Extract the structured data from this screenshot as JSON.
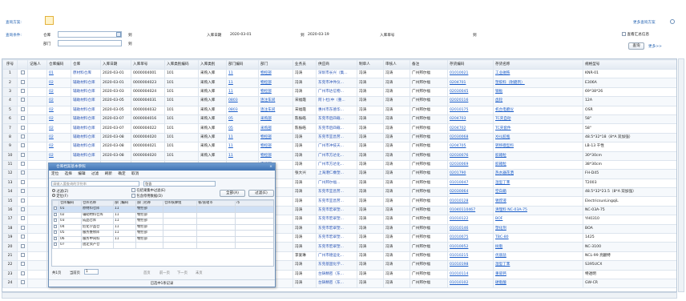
{
  "query_scheme": {
    "label": "查询方案:"
  },
  "more_schemes": "更多查询方案",
  "conditions": {
    "label": "查询条件:",
    "warehouse": "仓库",
    "to1": "到",
    "dept": "部门",
    "in_date": "入库日期",
    "date_from": "2020-03-01",
    "to2": "到",
    "date_to": "2020-03-19",
    "in_no": "入库单号",
    "to3": "到"
  },
  "summary_check": "查看汇总信息",
  "query_btn": "查询",
  "more_link": "更多>>",
  "columns": [
    "序号",
    "",
    "记账人",
    "仓库编码",
    "仓库",
    "入库日期",
    "入库单号",
    "入库类别编码",
    "入库类别",
    "部门编码",
    "部门",
    "业务员",
    "供应商",
    "制单人",
    "审核人",
    "备注",
    "存货编码",
    "存货名称",
    "规格型号"
  ],
  "rows": [
    [
      "1",
      "",
      "",
      "01",
      "原材料仓库",
      "2020-03-01",
      "0000004001",
      "101",
      "采购入库",
      "11",
      "物控部",
      "冯涛",
      "深圳市长兴（集...",
      "冯涛",
      "冯涛",
      "广州邦尔福",
      "01010021",
      "工业磁铁",
      "KNR-01"
    ],
    [
      "2",
      "",
      "",
      "02",
      "辅助材料仓库",
      "2020-03-01",
      "0000004023",
      "101",
      "采购入库",
      "11",
      "物控部",
      "冯涛",
      "东莞市冲件仪...",
      "冯涛",
      "冯涛",
      "广州邦尔福",
      "0204701",
      "塑胶料（耐磨剂）",
      "E306A"
    ],
    [
      "3",
      "",
      "",
      "02",
      "辅助材料仓库",
      "2020-03-03",
      "0000004024",
      "101",
      "采购入库",
      "11",
      "物控部",
      "冯涛",
      "广州市达信物...",
      "冯涛",
      "冯涛",
      "广州邦尔福",
      "02030045",
      "钢板",
      "69*38*26"
    ],
    [
      "4",
      "",
      "",
      "02",
      "辅助材料仓库",
      "2020-03-05",
      "0000004031",
      "101",
      "采购入库",
      "0803",
      "连注车间",
      "宋福霞",
      "阿卜杜(中（重...",
      "冯涛",
      "冯涛",
      "广州邦尔福",
      "02020116",
      "齿轮",
      "12A"
    ],
    [
      "5",
      "",
      "",
      "02",
      "辅助材料仓库",
      "2020-03-05",
      "0000004032",
      "101",
      "采购入库",
      "0803",
      "连注车间",
      "宋福霞",
      "惠州市东德华...",
      "冯涛",
      "冯涛",
      "广州邦尔福",
      "02010175",
      "机台电磨仪",
      "OSR"
    ],
    [
      "6",
      "",
      "",
      "02",
      "辅助材料仓库",
      "2020-03-07",
      "0000004016",
      "101",
      "采购入库",
      "05",
      "采购部",
      "陈振皓",
      "东莞市后四载...",
      "冯涛",
      "冯涛",
      "广州邦尔福",
      "0204703",
      "TC夹自动",
      "58\""
    ],
    [
      "7",
      "",
      "",
      "02",
      "辅助材料仓库",
      "2020-03-07",
      "0000004022",
      "101",
      "采购入库",
      "05",
      "采购部",
      "陈振皓",
      "东莞市后四载...",
      "冯涛",
      "冯涛",
      "广州邦尔福",
      "0204702",
      "TC夹套件",
      "58\""
    ],
    [
      "8",
      "",
      "",
      "02",
      "辅助材料仓库",
      "2020-03-08",
      "0000004020",
      "101",
      "采购入库",
      "11",
      "物控部",
      "冯涛",
      "东莞市宜昌劳...",
      "冯涛",
      "冯涛",
      "广州邦尔福",
      "02030068",
      "XHL胶瓶",
      "48.5*32*18（8*A 双加强）"
    ],
    [
      "9",
      "",
      "",
      "02",
      "辅助材料仓库",
      "2020-03-08",
      "0000004021",
      "101",
      "采购入库",
      "11",
      "物控部",
      "冯涛",
      "广州市冲技天...",
      "冯涛",
      "冯涛",
      "广州邦尔福",
      "0204705",
      "转移膜型料",
      "LB-13 干性"
    ],
    [
      "10",
      "",
      "",
      "02",
      "辅助材料仓库",
      "2020-03-08",
      "0000004020",
      "101",
      "采购入库",
      "11",
      "物控部",
      "冯涛",
      "广州市方达化...",
      "冯涛",
      "冯涛",
      "广州邦尔福",
      "02030076",
      "胶箱粒",
      "30*30cm"
    ],
    [
      "11",
      "",
      "",
      "",
      "",
      "",
      "",
      "",
      "",
      "",
      "物控部",
      "冯涛",
      "广州市方达化...",
      "冯涛",
      "冯涛",
      "广州邦尔福",
      "02030069",
      "胶箱粒",
      "38*30cm"
    ],
    [
      "12",
      "",
      "",
      "",
      "",
      "",
      "",
      "",
      "",
      "",
      "行政部",
      "张大兴",
      "上海港仁橡塑...",
      "冯涛",
      "冯涛",
      "广州邦尔福",
      "0201790",
      "热水器花洒",
      "FH-D45"
    ],
    [
      "13",
      "",
      "",
      "",
      "",
      "",
      "",
      "",
      "",
      "",
      "物控部",
      "冯涛",
      "广州邦尔福...",
      "冯涛",
      "冯涛",
      "广州邦尔福",
      "01010047",
      "湿型丁苯",
      "T2003"
    ],
    [
      "14",
      "",
      "",
      "",
      "",
      "",
      "",
      "",
      "",
      "",
      "物控部",
      "冯涛",
      "东莞市宜昌劳...",
      "冯涛",
      "冯涛",
      "广州邦尔福",
      "02030064",
      "空白箱",
      "48.5*32*23.5（8*A 双加强）"
    ],
    [
      "15",
      "",
      "",
      "",
      "",
      "",
      "",
      "",
      "",
      "",
      "物控部",
      "冯涛",
      "东莞市宜昌劳...",
      "冯涛",
      "冯涛",
      "广州邦尔福",
      "01010128",
      "锡焊液",
      "ElectricsunLingqiL"
    ],
    [
      "16",
      "",
      "",
      "",
      "",
      "",
      "",
      "",
      "",
      "",
      "物控部",
      "冯涛",
      "东莞市宏翠塑...",
      "冯涛",
      "冯涛",
      "广州邦尔福",
      "01040110467",
      "清理料 NC-03A-75",
      "NC-03A-75"
    ],
    [
      "17",
      "",
      "",
      "",
      "",
      "",
      "",
      "",
      "",
      "",
      "物控部",
      "冯涛",
      "东莞市宏翠塑...",
      "冯涛",
      "冯涛",
      "广州邦尔福",
      "01010122",
      "BOF",
      "YH0310"
    ],
    [
      "18",
      "",
      "",
      "",
      "",
      "",
      "",
      "",
      "",
      "",
      "物控部",
      "冯涛",
      "东莞市宏翠塑...",
      "冯涛",
      "冯涛",
      "广州邦尔福",
      "01010146",
      "塑化剂",
      "BOA"
    ],
    [
      "19",
      "",
      "",
      "",
      "",
      "",
      "",
      "",
      "",
      "",
      "物控部",
      "冯涛",
      "东莞市宏翠塑...",
      "冯涛",
      "冯涛",
      "广州邦尔福",
      "01010075",
      "TBC-80",
      "1425"
    ],
    [
      "20",
      "",
      "",
      "",
      "",
      "",
      "",
      "",
      "",
      "",
      "物控部",
      "冯涛",
      "东莞市宏翠塑...",
      "冯涛",
      "冯涛",
      "广州邦尔福",
      "01010052",
      "树脂",
      "NC-3100"
    ],
    [
      "21",
      "",
      "",
      "",
      "",
      "",
      "",
      "",
      "",
      "",
      "物控部",
      "李爱琳",
      "广州市德运化...",
      "冯涛",
      "冯涛",
      "广州邦尔福",
      "01010215",
      "优丽盐",
      "NCL-99  亮翻特"
    ],
    [
      "22",
      "",
      "",
      "",
      "",
      "",
      "",
      "",
      "",
      "",
      "物控部",
      "冯涛",
      "东莞基固化学...",
      "冯涛",
      "冯涛",
      "广州邦尔福",
      "01010198",
      "湿型丁苯",
      "S395UCX"
    ],
    [
      "23",
      "",
      "",
      "",
      "",
      "",
      "",
      "",
      "",
      "",
      "物控部",
      "冯涛",
      "台铸精密（东...",
      "冯涛",
      "冯涛",
      "广州邦尔福",
      "01010114",
      "重碳钙",
      "特透明"
    ],
    [
      "24",
      "",
      "",
      "",
      "",
      "",
      "",
      "",
      "",
      "",
      "物控部",
      "冯涛",
      "台铸精密（东...",
      "冯涛",
      "冯涛",
      "广州邦尔福",
      "01010102",
      "硬脂酸",
      "GW-CR"
    ]
  ],
  "dialog": {
    "title": "仓库档案基本参照",
    "toolbar": [
      "定位",
      "选择",
      "编辑",
      "过滤",
      "刷新",
      "确定",
      "取消"
    ],
    "search_placeholder": "请输入要查询的字符串",
    "contains_label": "包含",
    "radio_filter": "过滤(Z)",
    "radio_locate": "定位(F)",
    "chk_in_result": "在结果集中过滤(E)",
    "chk_contain": "包含停用数据(D)",
    "btn_all": "全部(A)",
    "btn_filter": "过滤(E)",
    "columns": [
      "",
      "仓库编码",
      "仓库名称",
      "部门编码",
      "部门名称",
      "仓库核算组",
      "省/直辖市",
      "市"
    ],
    "rows": [
      [
        "",
        "01",
        "原材料仓库",
        "11",
        "物控部",
        "",
        "",
        ""
      ],
      [
        "",
        "02",
        "辅助材料仓库",
        "11",
        "物控部",
        "",
        "",
        ""
      ],
      [
        "",
        "03",
        "成品仓库",
        "11",
        "物控部",
        "",
        "",
        ""
      ],
      [
        "",
        "04",
        "危化学品仓",
        "11",
        "物控部",
        "",
        "",
        ""
      ],
      [
        "",
        "05",
        "服务维修库",
        "11",
        "物控部",
        "",
        "",
        ""
      ],
      [
        "",
        "06",
        "服务中间料",
        "11",
        "物控部",
        "",
        "",
        ""
      ],
      [
        "",
        "07",
        "固定资产仓",
        "",
        "",
        "",
        "",
        ""
      ]
    ],
    "footer": {
      "total": "共1页",
      "current_label": "当前页",
      "current": "1",
      "first": "首页",
      "prev": "前一页",
      "next": "下一页",
      "last": "末页"
    },
    "status": "已选中1条记录"
  }
}
